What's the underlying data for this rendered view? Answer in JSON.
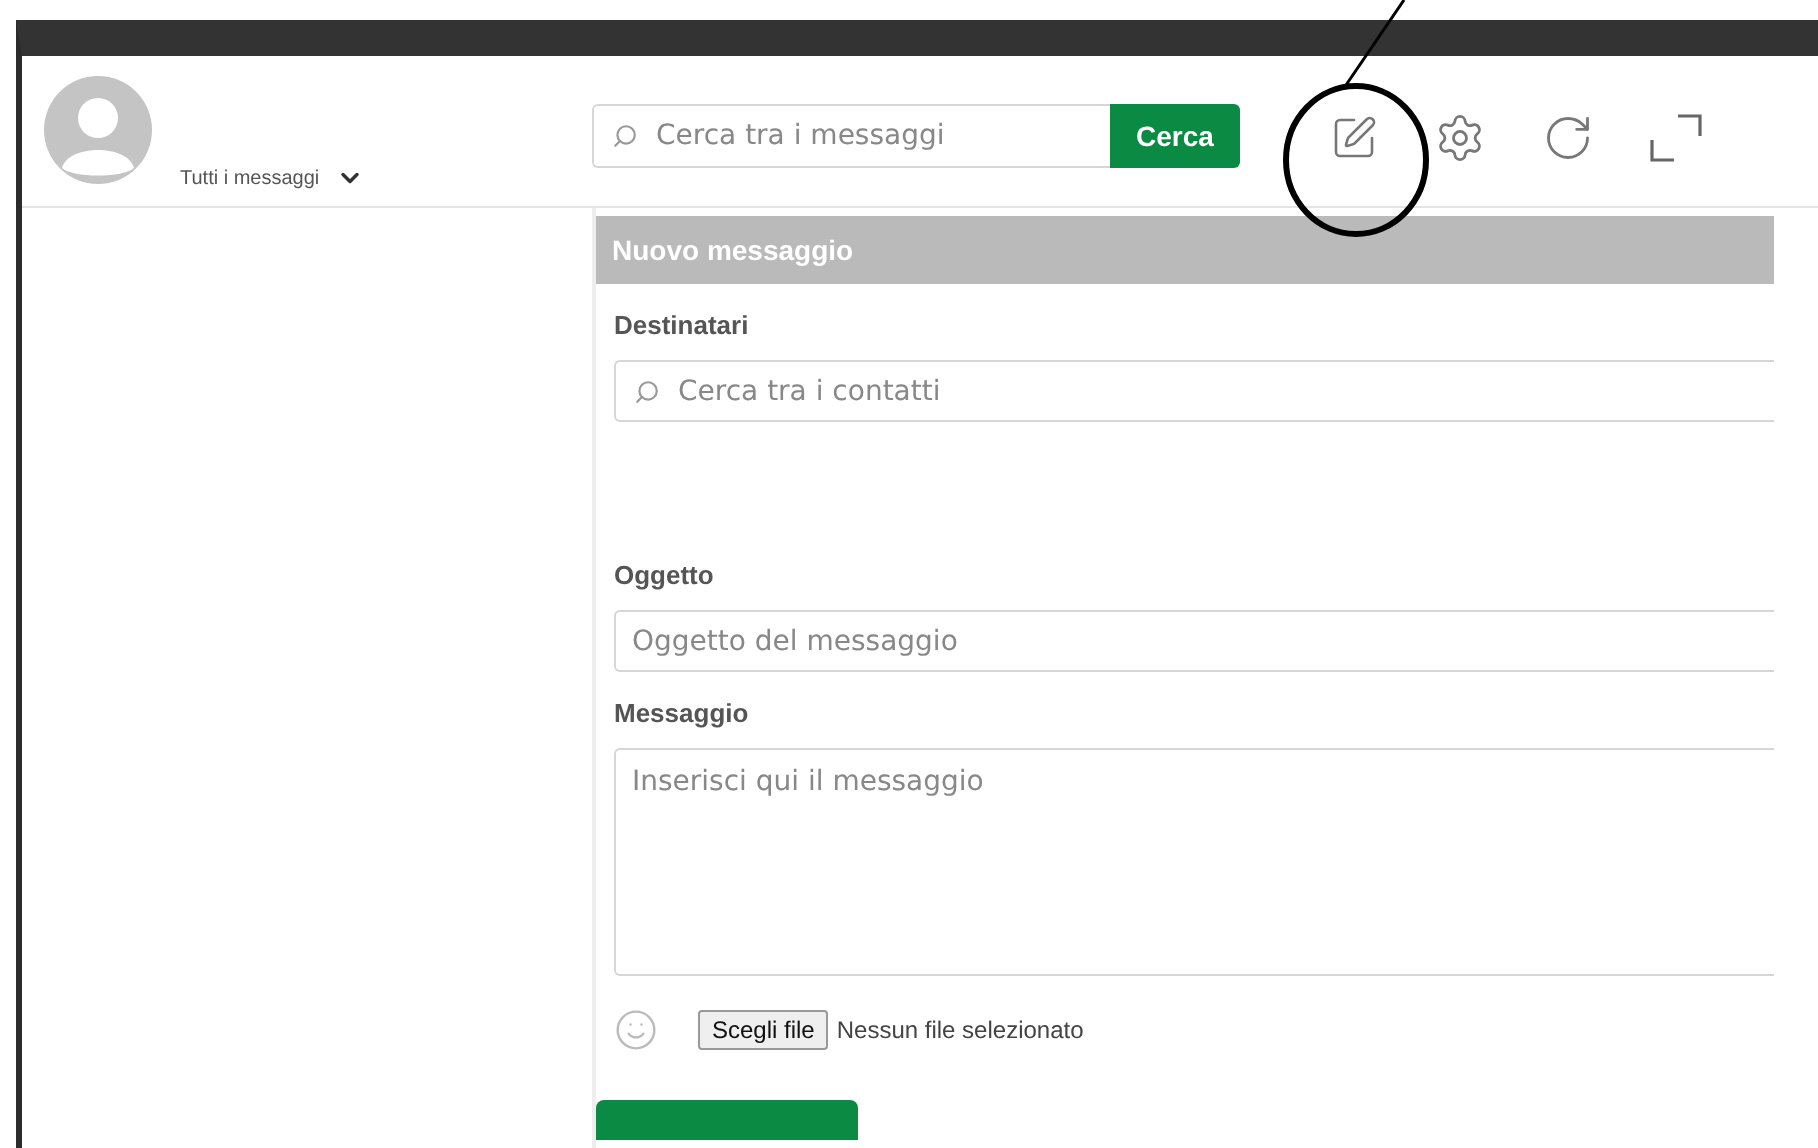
{
  "header": {
    "filter": {
      "label": "Tutti i messaggi"
    },
    "search": {
      "placeholder": "Cerca tra i messaggi",
      "button": "Cerca"
    }
  },
  "compose": {
    "title": "Nuovo messaggio",
    "fields": [
      {
        "kind": "search",
        "label": "Destinatari",
        "placeholder": "Cerca tra i contatti"
      },
      {
        "kind": "text",
        "label": "Oggetto",
        "placeholder": "Oggetto del messaggio"
      },
      {
        "kind": "textarea",
        "label": "Messaggio",
        "placeholder": "Inserisci qui il messaggio"
      }
    ],
    "attachment": {
      "button": "Scegli file",
      "status": "Nessun file selezionato"
    }
  }
}
